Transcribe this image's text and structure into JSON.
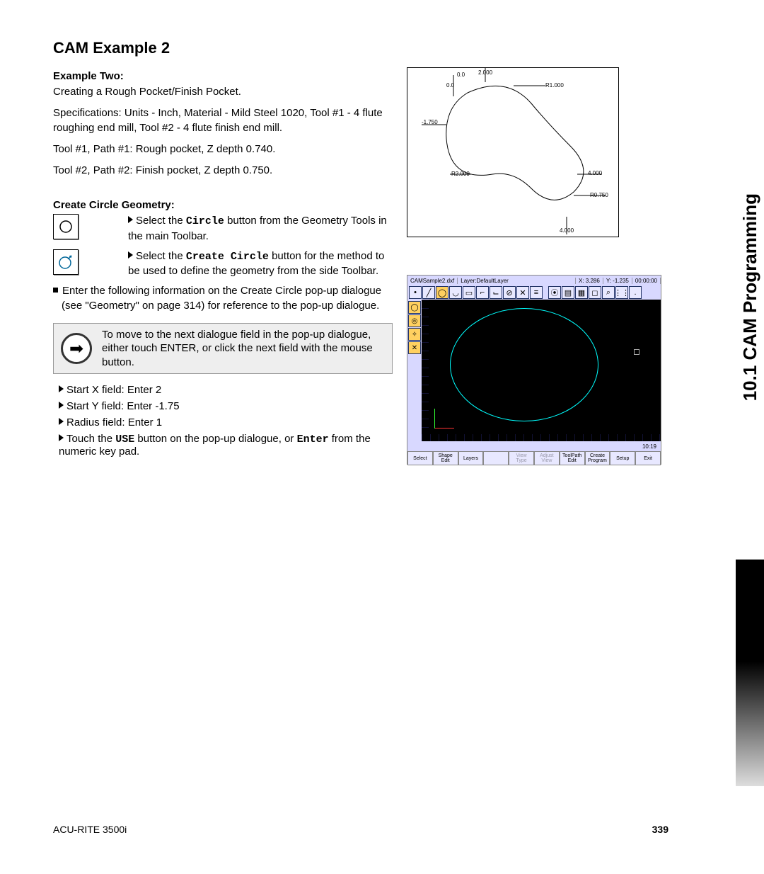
{
  "side_tab": "10.1 CAM Programming",
  "heading": "CAM Example 2",
  "example_label": "Example Two:",
  "p1": "Creating a Rough Pocket/Finish Pocket.",
  "p2": "Specifications: Units - Inch, Material - Mild Steel 1020, Tool #1 - 4 flute roughing end mill, Tool #2 - 4 flute finish end mill.",
  "p3": "Tool #1, Path #1: Rough pocket, Z depth 0.740.",
  "p4": "Tool #2, Path #2: Finish pocket, Z depth 0.750.",
  "sec2_head": "Create Circle Geometry:",
  "row1_a": "Select the ",
  "row1_b": "Circle",
  "row1_c": " button from the Geometry Tools in the main Toolbar.",
  "row2_a": "Select the ",
  "row2_b": "Create Circle",
  "row2_c": " button for the method to be used to define the geometry from the side Toolbar.",
  "bullet1": "Enter the following information on the Create Circle pop-up dialogue (see \"Geometry\" on page 314) for reference to the pop-up dialogue.",
  "note": "To move to the next dialogue field in the pop-up dialogue, either touch ENTER, or click the next field with the mouse button.",
  "step1": "Start X field: Enter 2",
  "step2": "Start Y field: Enter -1.75",
  "step3": "Radius field: Enter 1",
  "step4_a": "Touch the ",
  "step4_b": "USE",
  "step4_c": " button on the pop-up dialogue, or ",
  "step4_d": "Enter",
  "step4_e": " from the numeric key pad.",
  "tech": {
    "r1000": "R1.000",
    "n1750": "-1.750",
    "r2000": "R2.000",
    "n4000": "4.000",
    "r0750": "R0.750",
    "n4000b": "4.000",
    "n2000t": "2.000",
    "n00": "0.0",
    "n00t": "0.0"
  },
  "cam": {
    "file": "CAMSample2.dxf",
    "layer": "Layer:DefaultLayer",
    "x": "X: 3.286",
    "y": "Y: -1.235",
    "time": "00:00:00",
    "clock": "10:19",
    "softkeys": [
      "Select",
      "Shape Edit",
      "Layers",
      "",
      "View Type",
      "Adjust View",
      "ToolPath Edit",
      "Create Program",
      "Setup",
      "Exit"
    ]
  },
  "footer_left": "ACU-RITE 3500i",
  "footer_right": "339"
}
